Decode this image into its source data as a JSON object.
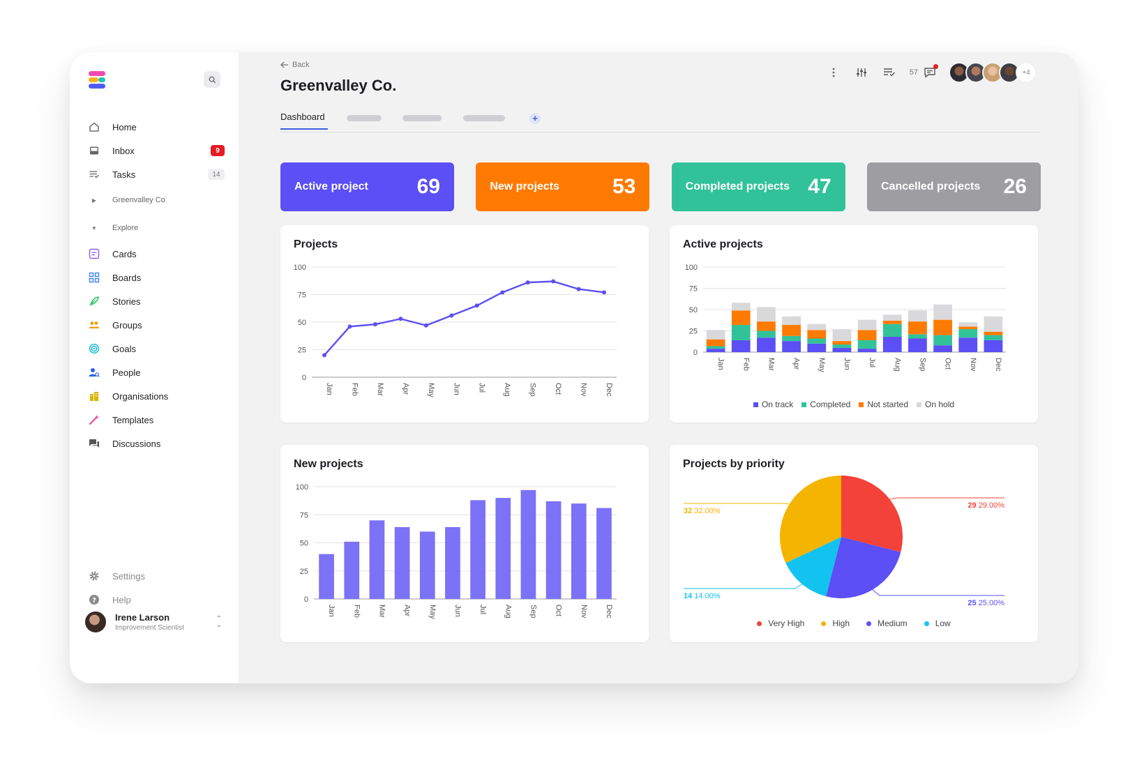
{
  "sidebar": {
    "nav": [
      {
        "label": "Home",
        "icon": "home-icon"
      },
      {
        "label": "Inbox",
        "icon": "inbox-icon",
        "badge": "9"
      },
      {
        "label": "Tasks",
        "icon": "tasks-icon",
        "badge": "14"
      }
    ],
    "workspace_section": "Greenvalley Co",
    "explore_section": "Explore",
    "explore": [
      {
        "label": "Cards",
        "icon": "cards-icon",
        "color": "#8b5cf6"
      },
      {
        "label": "Boards",
        "icon": "boards-icon",
        "color": "#3b82f6"
      },
      {
        "label": "Stories",
        "icon": "stories-icon",
        "color": "#22c55e"
      },
      {
        "label": "Groups",
        "icon": "groups-icon",
        "color": "#f59e0b"
      },
      {
        "label": "Goals",
        "icon": "goals-icon",
        "color": "#06b6d4"
      },
      {
        "label": "People",
        "icon": "people-icon",
        "color": "#2563eb"
      },
      {
        "label": "Organisations",
        "icon": "organisations-icon",
        "color": "#d9b200"
      },
      {
        "label": "Templates",
        "icon": "templates-icon",
        "color": "#ec4899"
      },
      {
        "label": "Discussions",
        "icon": "discussions-icon",
        "color": "#555555"
      }
    ],
    "settings_label": "Settings",
    "help_label": "Help",
    "user": {
      "name": "Irene Larson",
      "role": "Improvement Scientist"
    }
  },
  "header": {
    "back_label": "Back",
    "title": "Greenvalley Co.",
    "notification_count": "57",
    "more_avatars": "+4"
  },
  "tabs": {
    "active": "Dashboard",
    "add": "+"
  },
  "stats": [
    {
      "label": "Active project",
      "value": "69",
      "color": "#5b4ff5"
    },
    {
      "label": "New projects",
      "value": "53",
      "color": "#ff7a00"
    },
    {
      "label": "Completed projects",
      "value": "47",
      "color": "#32c29a"
    },
    {
      "label": "Cancelled projects",
      "value": "26",
      "color": "#9e9ea2"
    }
  ],
  "chart_data": [
    {
      "type": "line",
      "title": "Projects",
      "categories": [
        "Jan",
        "Feb",
        "Mar",
        "Apr",
        "May",
        "Jun",
        "Jul",
        "Aug",
        "Sep",
        "Oct",
        "Nov",
        "Dec"
      ],
      "values": [
        20,
        46,
        48,
        53,
        47,
        56,
        65,
        77,
        86,
        87,
        80,
        77
      ],
      "ylim": [
        0,
        100
      ],
      "yticks": [
        0,
        25,
        50,
        75,
        100
      ],
      "color": "#5b4ff5",
      "grid": true
    },
    {
      "type": "bar",
      "stacked": true,
      "title": "Active projects",
      "categories": [
        "Jan",
        "Feb",
        "Mar",
        "Apr",
        "May",
        "Jun",
        "Jul",
        "Aug",
        "Sep",
        "Oct",
        "Nov",
        "Dec"
      ],
      "ylim": [
        0,
        100
      ],
      "yticks": [
        0,
        25,
        50,
        75,
        100
      ],
      "legend_position": "bottom",
      "series": [
        {
          "name": "On track",
          "color": "#5b4ff5",
          "values": [
            4,
            14,
            17,
            13,
            10,
            5,
            4,
            18,
            16,
            8,
            17,
            14
          ]
        },
        {
          "name": "Completed",
          "color": "#32c29a",
          "values": [
            3,
            18,
            8,
            6,
            6,
            4,
            10,
            15,
            5,
            12,
            10,
            6
          ]
        },
        {
          "name": "Not started",
          "color": "#ff7a00",
          "values": [
            8,
            17,
            11,
            13,
            10,
            4,
            12,
            4,
            15,
            18,
            3,
            4
          ]
        },
        {
          "name": "On hold",
          "color": "#d9d9db",
          "values": [
            11,
            9,
            17,
            10,
            7,
            14,
            12,
            7,
            13,
            18,
            5,
            18
          ]
        }
      ],
      "grid": true
    },
    {
      "type": "bar",
      "title": "New projects",
      "categories": [
        "Jan",
        "Feb",
        "Mar",
        "Apr",
        "May",
        "Jun",
        "Jul",
        "Aug",
        "Sep",
        "Oct",
        "Nov",
        "Dec"
      ],
      "values": [
        40,
        51,
        70,
        64,
        60,
        64,
        88,
        90,
        97,
        87,
        85,
        81
      ],
      "ylim": [
        0,
        100
      ],
      "yticks": [
        0,
        25,
        50,
        75,
        100
      ],
      "color": "#7b72f7",
      "grid": true
    },
    {
      "type": "pie",
      "title": "Projects by priority",
      "legend_position": "bottom",
      "slices": [
        {
          "name": "Very High",
          "value": 29,
          "percent": "29.00%",
          "color": "#f2423a",
          "side": "right"
        },
        {
          "name": "Medium",
          "value": 25,
          "percent": "25.00%",
          "color": "#5b4ff5",
          "side": "right"
        },
        {
          "name": "Low",
          "value": 14,
          "percent": "14.00%",
          "color": "#12c3f0",
          "side": "left"
        },
        {
          "name": "High",
          "value": 32,
          "percent": "32.00%",
          "color": "#f5b400",
          "side": "left"
        }
      ],
      "legend_order": [
        "Very High",
        "High",
        "Medium",
        "Low"
      ]
    }
  ]
}
